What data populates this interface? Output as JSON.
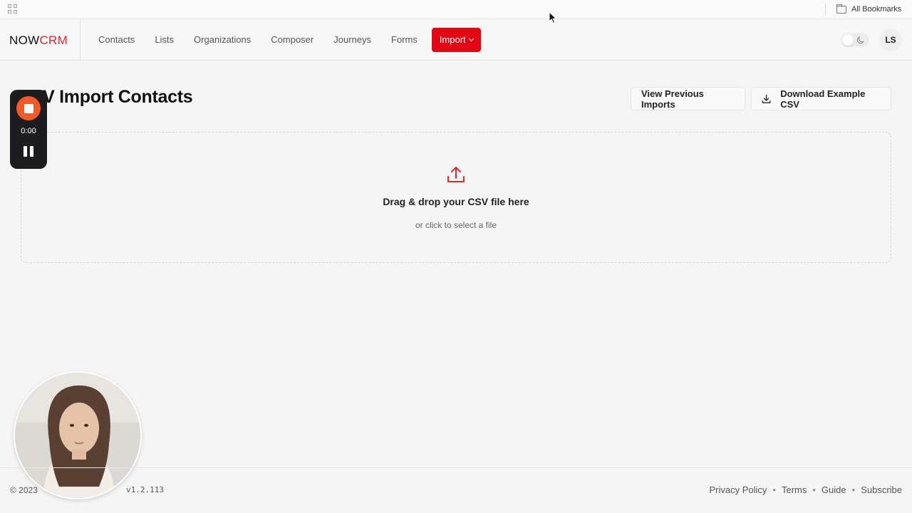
{
  "browser": {
    "bookmarks_label": "All Bookmarks"
  },
  "navbar": {
    "logo_now": "NOW",
    "logo_crm": "CRM",
    "links": [
      "Contacts",
      "Lists",
      "Organizations",
      "Composer",
      "Journeys",
      "Forms"
    ],
    "import_label": "Import",
    "avatar_initials": "LS",
    "accent_color": "#e30613"
  },
  "page": {
    "title": "CSV Import Contacts",
    "view_previous_label": "View Previous Imports",
    "download_example_label": "Download Example CSV"
  },
  "dropzone": {
    "title": "Drag & drop your CSV file here",
    "subtitle": "or click to select a file"
  },
  "recorder": {
    "time": "0:00"
  },
  "footer": {
    "copyright": "© 2023",
    "version": "v1.2.113",
    "links": [
      "Privacy Policy",
      "Terms",
      "Guide",
      "Subscribe"
    ]
  }
}
